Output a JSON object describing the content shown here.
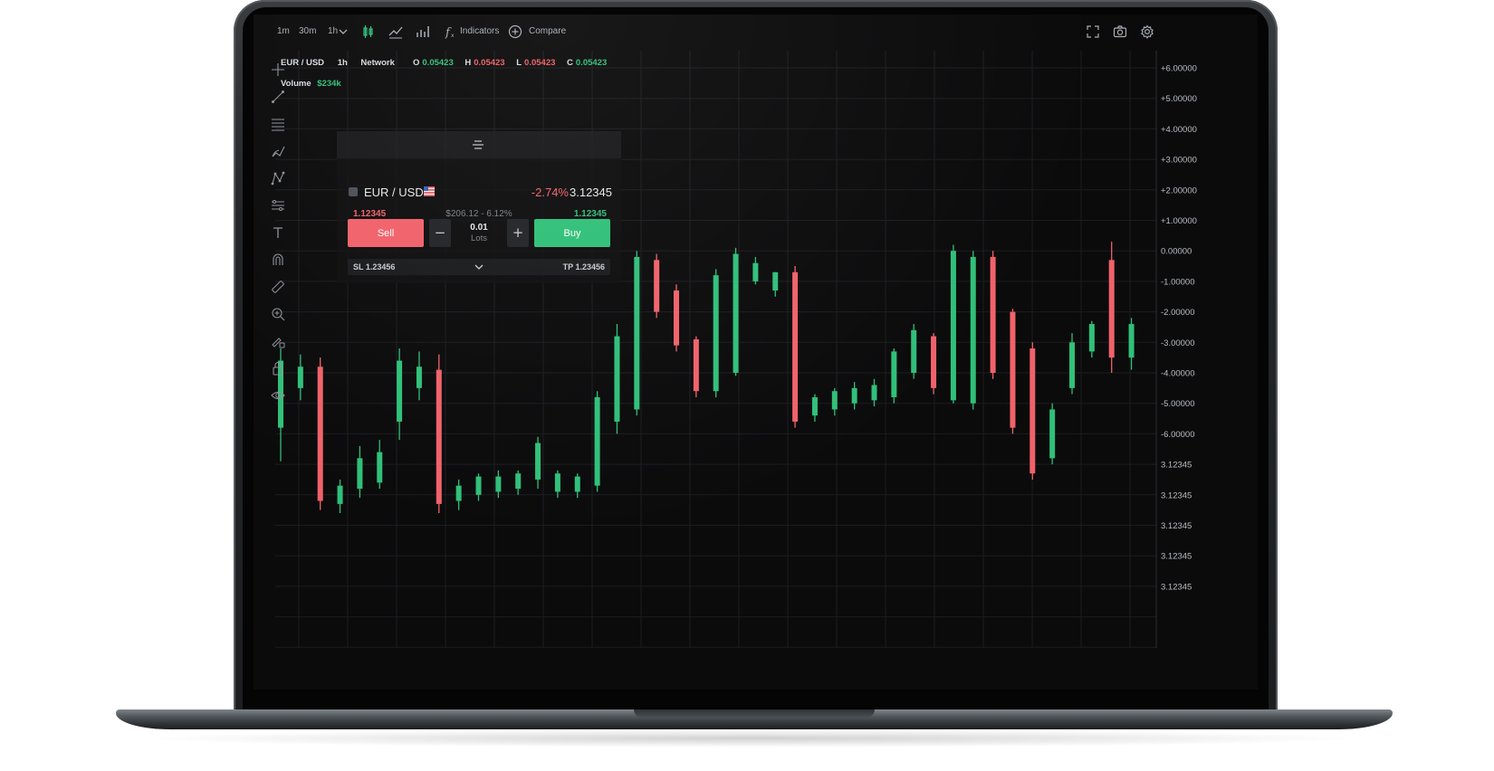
{
  "toolbar": {
    "timeframes": [
      "1m",
      "30m",
      "1h"
    ],
    "indicators_label": "Indicators",
    "compare_label": "Compare",
    "icons": [
      "candles-icon",
      "line-chart-icon",
      "bar-chart-icon",
      "function-icon",
      "plus-circle-icon",
      "fullscreen-icon",
      "camera-icon",
      "gear-icon"
    ]
  },
  "legend": {
    "symbol": "EUR / USD",
    "interval": "1h",
    "source": "Network",
    "o_label": "O",
    "o_value": "0.05423",
    "h_label": "H",
    "h_value": "0.05423",
    "l_label": "L",
    "l_value": "0.05423",
    "c_label": "C",
    "c_value": "0.05423",
    "volume_label": "Volume",
    "volume_value": "$234k"
  },
  "order_panel": {
    "symbol": "EUR / USD",
    "change": "-2.74%",
    "price": "3.12345",
    "sell_price": "1.12345",
    "spread": "$206.12 - 6.12%",
    "buy_price": "1.12345",
    "sell_label": "Sell",
    "buy_label": "Buy",
    "minus_label": "−",
    "plus_label": "+",
    "lots_value": "0.01",
    "lots_label": "Lots",
    "sl_label": "SL 1.23456",
    "tp_label": "TP 1.23456"
  },
  "left_tools": [
    "crosshair-icon",
    "trend-line-icon",
    "fib-retracement-icon",
    "brush-icon",
    "pattern-icon",
    "measure-icon",
    "text-icon",
    "magnet-icon",
    "ruler-icon",
    "zoom-in-icon",
    "lock-drawings-icon",
    "lock-icon",
    "eye-icon"
  ],
  "colors": {
    "up": "#30c079",
    "down": "#f1626a",
    "background": "#0b0b0c",
    "grid": "#1c1d20",
    "axis_text": "#b9bdc1"
  },
  "chart_data": {
    "type": "candlestick",
    "y_axis_labels": [
      "+6.00000",
      "+5.00000",
      "+4.00000",
      "+3.00000",
      "+2.00000",
      "+1.00000",
      "0.00000",
      "-1.00000",
      "-2.00000",
      "-3.00000",
      "-4.00000",
      "-5.00000",
      "-6.00000",
      "3.12345",
      "3.12345",
      "3.12345",
      "3.12345",
      "3.12345"
    ],
    "ylim": [
      -12,
      6
    ],
    "grid": true,
    "candles": [
      {
        "o": -5.8,
        "h": -3.2,
        "l": -6.9,
        "c": -3.6
      },
      {
        "o": -4.5,
        "h": -3.4,
        "l": -4.9,
        "c": -3.8
      },
      {
        "o": -3.8,
        "h": -3.5,
        "l": -8.5,
        "c": -8.2
      },
      {
        "o": -8.3,
        "h": -7.5,
        "l": -8.6,
        "c": -7.7
      },
      {
        "o": -7.8,
        "h": -6.4,
        "l": -8.1,
        "c": -6.8
      },
      {
        "o": -7.6,
        "h": -6.2,
        "l": -7.8,
        "c": -6.6
      },
      {
        "o": -5.6,
        "h": -3.2,
        "l": -6.2,
        "c": -3.6
      },
      {
        "o": -4.5,
        "h": -3.3,
        "l": -4.9,
        "c": -3.8
      },
      {
        "o": -3.9,
        "h": -3.4,
        "l": -8.6,
        "c": -8.3
      },
      {
        "o": -8.2,
        "h": -7.5,
        "l": -8.5,
        "c": -7.7
      },
      {
        "o": -8.0,
        "h": -7.3,
        "l": -8.2,
        "c": -7.4
      },
      {
        "o": -7.9,
        "h": -7.2,
        "l": -8.1,
        "c": -7.4
      },
      {
        "o": -7.8,
        "h": -7.2,
        "l": -8.0,
        "c": -7.3
      },
      {
        "o": -7.5,
        "h": -6.1,
        "l": -7.8,
        "c": -6.3
      },
      {
        "o": -7.9,
        "h": -7.2,
        "l": -8.1,
        "c": -7.3
      },
      {
        "o": -7.9,
        "h": -7.3,
        "l": -8.1,
        "c": -7.4
      },
      {
        "o": -7.7,
        "h": -4.6,
        "l": -7.9,
        "c": -4.8
      },
      {
        "o": -5.6,
        "h": -2.4,
        "l": -6.0,
        "c": -2.8
      },
      {
        "o": -5.2,
        "h": 0.0,
        "l": -5.4,
        "c": -0.2
      },
      {
        "o": -0.3,
        "h": -0.1,
        "l": -2.2,
        "c": -2.0
      },
      {
        "o": -1.3,
        "h": -1.1,
        "l": -3.3,
        "c": -3.1
      },
      {
        "o": -2.9,
        "h": -2.8,
        "l": -4.8,
        "c": -4.6
      },
      {
        "o": -4.6,
        "h": -0.6,
        "l": -4.8,
        "c": -0.8
      },
      {
        "o": -4.0,
        "h": 0.1,
        "l": -4.1,
        "c": -0.1
      },
      {
        "o": -1.0,
        "h": -0.2,
        "l": -1.1,
        "c": -0.4
      },
      {
        "o": -1.3,
        "h": -0.7,
        "l": -1.5,
        "c": -0.7
      },
      {
        "o": -0.7,
        "h": -0.5,
        "l": -5.8,
        "c": -5.6
      },
      {
        "o": -5.4,
        "h": -4.7,
        "l": -5.6,
        "c": -4.8
      },
      {
        "o": -5.2,
        "h": -4.5,
        "l": -5.4,
        "c": -4.6
      },
      {
        "o": -5.0,
        "h": -4.3,
        "l": -5.2,
        "c": -4.5
      },
      {
        "o": -4.9,
        "h": -4.2,
        "l": -5.1,
        "c": -4.4
      },
      {
        "o": -4.8,
        "h": -3.2,
        "l": -5.0,
        "c": -3.3
      },
      {
        "o": -4.0,
        "h": -2.4,
        "l": -4.2,
        "c": -2.6
      },
      {
        "o": -2.8,
        "h": -2.7,
        "l": -4.7,
        "c": -4.5
      },
      {
        "o": -4.9,
        "h": 0.2,
        "l": -5.0,
        "c": 0.0
      },
      {
        "o": -5.0,
        "h": 0.0,
        "l": -5.2,
        "c": -0.2
      },
      {
        "o": -0.2,
        "h": 0.0,
        "l": -4.2,
        "c": -4.0
      },
      {
        "o": -2.0,
        "h": -1.9,
        "l": -6.0,
        "c": -5.8
      },
      {
        "o": -3.2,
        "h": -3.0,
        "l": -7.5,
        "c": -7.3
      },
      {
        "o": -6.8,
        "h": -5.0,
        "l": -7.0,
        "c": -5.2
      },
      {
        "o": -4.5,
        "h": -2.7,
        "l": -4.7,
        "c": -3.0
      },
      {
        "o": -3.3,
        "h": -2.3,
        "l": -3.5,
        "c": -2.4
      },
      {
        "o": -0.3,
        "h": 0.3,
        "l": -4.0,
        "c": -3.5
      },
      {
        "o": -3.5,
        "h": -2.2,
        "l": -3.9,
        "c": -2.4
      }
    ]
  }
}
